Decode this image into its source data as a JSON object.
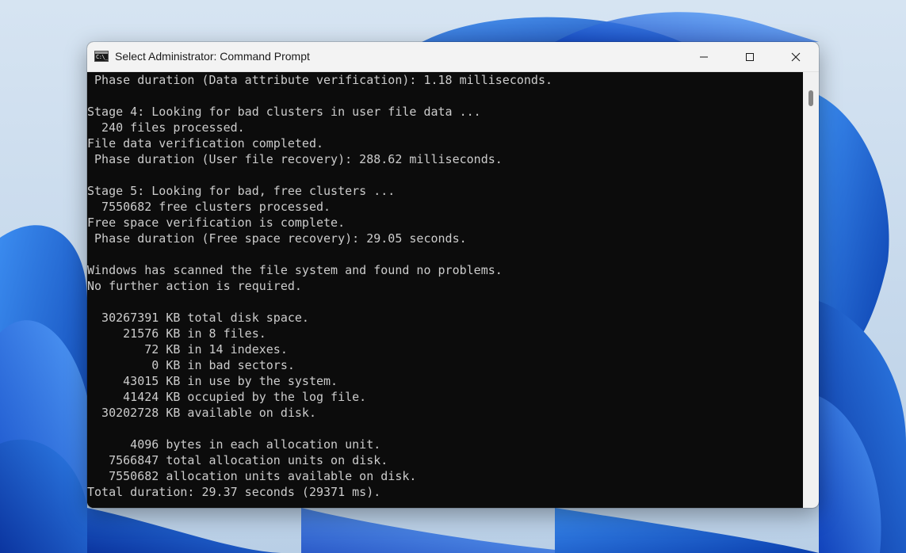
{
  "window": {
    "title": "Select Administrator: Command Prompt",
    "icon_label": "C:\\_",
    "controls": {
      "minimize": "minimize-icon",
      "maximize": "maximize-icon",
      "close": "close-icon"
    }
  },
  "console": {
    "lines": [
      " Phase duration (Data attribute verification): 1.18 milliseconds.",
      "",
      "Stage 4: Looking for bad clusters in user file data ...",
      "  240 files processed.",
      "File data verification completed.",
      " Phase duration (User file recovery): 288.62 milliseconds.",
      "",
      "Stage 5: Looking for bad, free clusters ...",
      "  7550682 free clusters processed.",
      "Free space verification is complete.",
      " Phase duration (Free space recovery): 29.05 seconds.",
      "",
      "Windows has scanned the file system and found no problems.",
      "No further action is required.",
      "",
      "  30267391 KB total disk space.",
      "     21576 KB in 8 files.",
      "        72 KB in 14 indexes.",
      "         0 KB in bad sectors.",
      "     43015 KB in use by the system.",
      "     41424 KB occupied by the log file.",
      "  30202728 KB available on disk.",
      "",
      "      4096 bytes in each allocation unit.",
      "   7566847 total allocation units on disk.",
      "   7550682 allocation units available on disk.",
      "Total duration: 29.37 seconds (29371 ms)."
    ]
  },
  "colors": {
    "console_bg": "#0c0c0c",
    "console_text": "#cccccc",
    "titlebar_bg": "#f3f3f3",
    "wallpaper_accent": "#1a5fd0"
  }
}
